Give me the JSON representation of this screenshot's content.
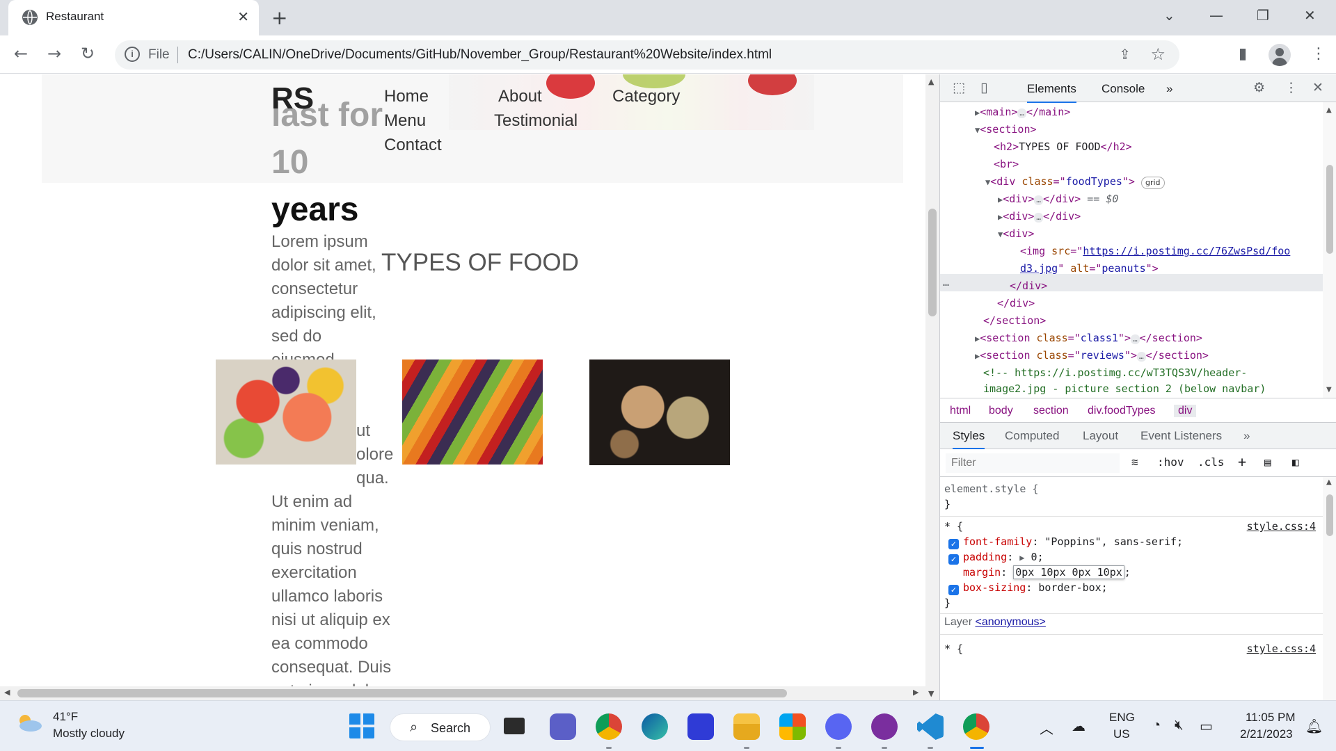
{
  "browser": {
    "tab_title": "Restaurant",
    "tab_close": "✕",
    "new_tab": "+",
    "url_scheme": "File",
    "url": "C:/Users/CALIN/OneDrive/Documents/GitHub/November_Group/Restaurant%20Website/index.html",
    "info_glyph": "i"
  },
  "page": {
    "logo": "RS",
    "hero_faded": "last for",
    "hero_number": "10",
    "hero_strong": "years",
    "nav": {
      "home": "Home",
      "about": "About",
      "category": "Category",
      "menu": "Menu",
      "testimonial": "Testimonial",
      "contact": "Contact"
    },
    "lorem_lines": [
      "Lorem ipsum",
      "dolor sit amet,",
      "consectetur",
      "adipiscing elit,",
      "sed do",
      "eiusmod",
      "",
      "",
      "ut",
      "olore",
      "qua.",
      "Ut enim ad",
      "minim veniam,",
      "quis nostrud",
      "exercitation",
      "ullamco laboris",
      "nisi ut aliquip ex",
      "ea commodo",
      "consequat. Duis",
      "aute irure dolor"
    ],
    "types_heading": "TYPES OF FOOD"
  },
  "devtools": {
    "tabs": {
      "elements": "Elements",
      "console": "Console",
      "more": "»"
    },
    "dom": {
      "main": "main",
      "section": "section",
      "h2_text": "TYPES OF FOOD",
      "br": "br",
      "div_class": "foodTypes",
      "grid_badge": "grid",
      "selected_marker": "== $0",
      "img_src_line1": "https://i.postimg.cc/76ZwsPsd/foo",
      "img_src_line2": "d3.jpg",
      "img_alt": "peanuts",
      "section_class1": "class1",
      "section_reviews": "reviews",
      "comment_line1": "<!-- https://i.postimg.cc/wT3TQS3V/header-",
      "comment_line2": "image2.jpg - picture section 2 (below navbar)"
    },
    "breadcrumbs": [
      "html",
      "body",
      "section",
      "div.foodTypes",
      "div"
    ],
    "panel_tabs": [
      "Styles",
      "Computed",
      "Layout",
      "Event Listeners",
      "»"
    ],
    "filter_placeholder": "Filter",
    "filter_tools": {
      "hov": ":hov",
      "cls": ".cls",
      "plus": "+"
    },
    "styles": {
      "element_style": "element.style {",
      "close_brace": "}",
      "universal_selector": "* {",
      "source": "style.css:4",
      "font_family_prop": "font-family",
      "font_family_val": "\"Poppins\", sans-serif;",
      "padding_prop": "padding",
      "padding_val": "0;",
      "margin_prop": "margin",
      "margin_val": "0px 10px 0px 10px",
      "box_sizing_prop": "box-sizing",
      "box_sizing_val": "border-box;",
      "layer_label": "Layer",
      "layer_link": "<anonymous>"
    }
  },
  "taskbar": {
    "temperature": "41°F",
    "condition": "Mostly cloudy",
    "search_label": "Search",
    "lang_top": "ENG",
    "lang_bottom": "US",
    "time": "11:05 PM",
    "date": "2/21/2023"
  },
  "colors": {
    "accent": "#1a73e8",
    "tag": "#881280",
    "attr": "#994500",
    "value": "#1a1aa6",
    "css_property": "#c80000"
  }
}
